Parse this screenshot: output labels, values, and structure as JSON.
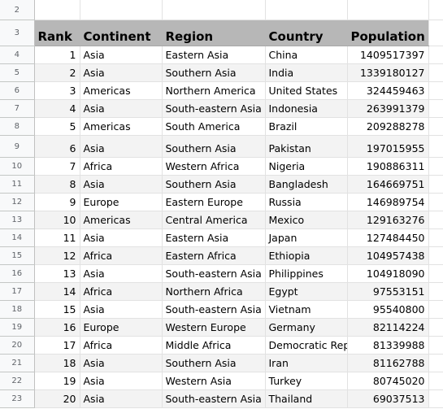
{
  "sheet": {
    "empty_row_number": "2",
    "header_row_number": "3",
    "columns": [
      "Rank",
      "Continent",
      "Region",
      "Country",
      "Population"
    ],
    "rows": [
      {
        "row": "4",
        "rank": "1",
        "continent": "Asia",
        "region": "Eastern Asia",
        "country": "China",
        "population": "1409517397"
      },
      {
        "row": "5",
        "rank": "2",
        "continent": "Asia",
        "region": "Southern Asia",
        "country": "India",
        "population": "1339180127"
      },
      {
        "row": "6",
        "rank": "3",
        "continent": "Americas",
        "region": "Northern America",
        "country": "United States",
        "population": "324459463"
      },
      {
        "row": "7",
        "rank": "4",
        "continent": "Asia",
        "region": "South-eastern Asia",
        "country": "Indonesia",
        "population": "263991379"
      },
      {
        "row": "8",
        "rank": "5",
        "continent": "Americas",
        "region": "South America",
        "country": "Brazil",
        "population": "209288278"
      },
      {
        "row": "9",
        "rank": "6",
        "continent": "Asia",
        "region": "Southern Asia",
        "country": "Pakistan",
        "population": "197015955"
      },
      {
        "row": "10",
        "rank": "7",
        "continent": "Africa",
        "region": "Western Africa",
        "country": "Nigeria",
        "population": "190886311"
      },
      {
        "row": "11",
        "rank": "8",
        "continent": "Asia",
        "region": "Southern Asia",
        "country": "Bangladesh",
        "population": "164669751"
      },
      {
        "row": "12",
        "rank": "9",
        "continent": "Europe",
        "region": "Eastern Europe",
        "country": "Russia",
        "population": "146989754"
      },
      {
        "row": "13",
        "rank": "10",
        "continent": "Americas",
        "region": "Central America",
        "country": "Mexico",
        "population": "129163276"
      },
      {
        "row": "14",
        "rank": "11",
        "continent": "Asia",
        "region": "Eastern Asia",
        "country": "Japan",
        "population": "127484450"
      },
      {
        "row": "15",
        "rank": "12",
        "continent": "Africa",
        "region": "Eastern Africa",
        "country": "Ethiopia",
        "population": "104957438"
      },
      {
        "row": "16",
        "rank": "13",
        "continent": "Asia",
        "region": "South-eastern Asia",
        "country": "Philippines",
        "population": "104918090"
      },
      {
        "row": "17",
        "rank": "14",
        "continent": "Africa",
        "region": "Northern Africa",
        "country": "Egypt",
        "population": "97553151"
      },
      {
        "row": "18",
        "rank": "15",
        "continent": "Asia",
        "region": "South-eastern Asia",
        "country": "Vietnam",
        "population": "95540800"
      },
      {
        "row": "19",
        "rank": "16",
        "continent": "Europe",
        "region": "Western Europe",
        "country": "Germany",
        "population": "82114224"
      },
      {
        "row": "20",
        "rank": "17",
        "continent": "Africa",
        "region": "Middle Africa",
        "country": "Democratic Repu",
        "population": "81339988"
      },
      {
        "row": "21",
        "rank": "18",
        "continent": "Asia",
        "region": "Southern Asia",
        "country": "Iran",
        "population": "81162788"
      },
      {
        "row": "22",
        "rank": "19",
        "continent": "Asia",
        "region": "Western Asia",
        "country": "Turkey",
        "population": "80745020"
      },
      {
        "row": "23",
        "rank": "20",
        "continent": "Asia",
        "region": "South-eastern Asia",
        "country": "Thailand",
        "population": "69037513"
      }
    ]
  },
  "colors": {
    "header_fill": "#b7b7b7",
    "band_fill": "#f3f3f3",
    "row_header_fill": "#f8f9fa",
    "grid_line": "#e2e2e2"
  }
}
